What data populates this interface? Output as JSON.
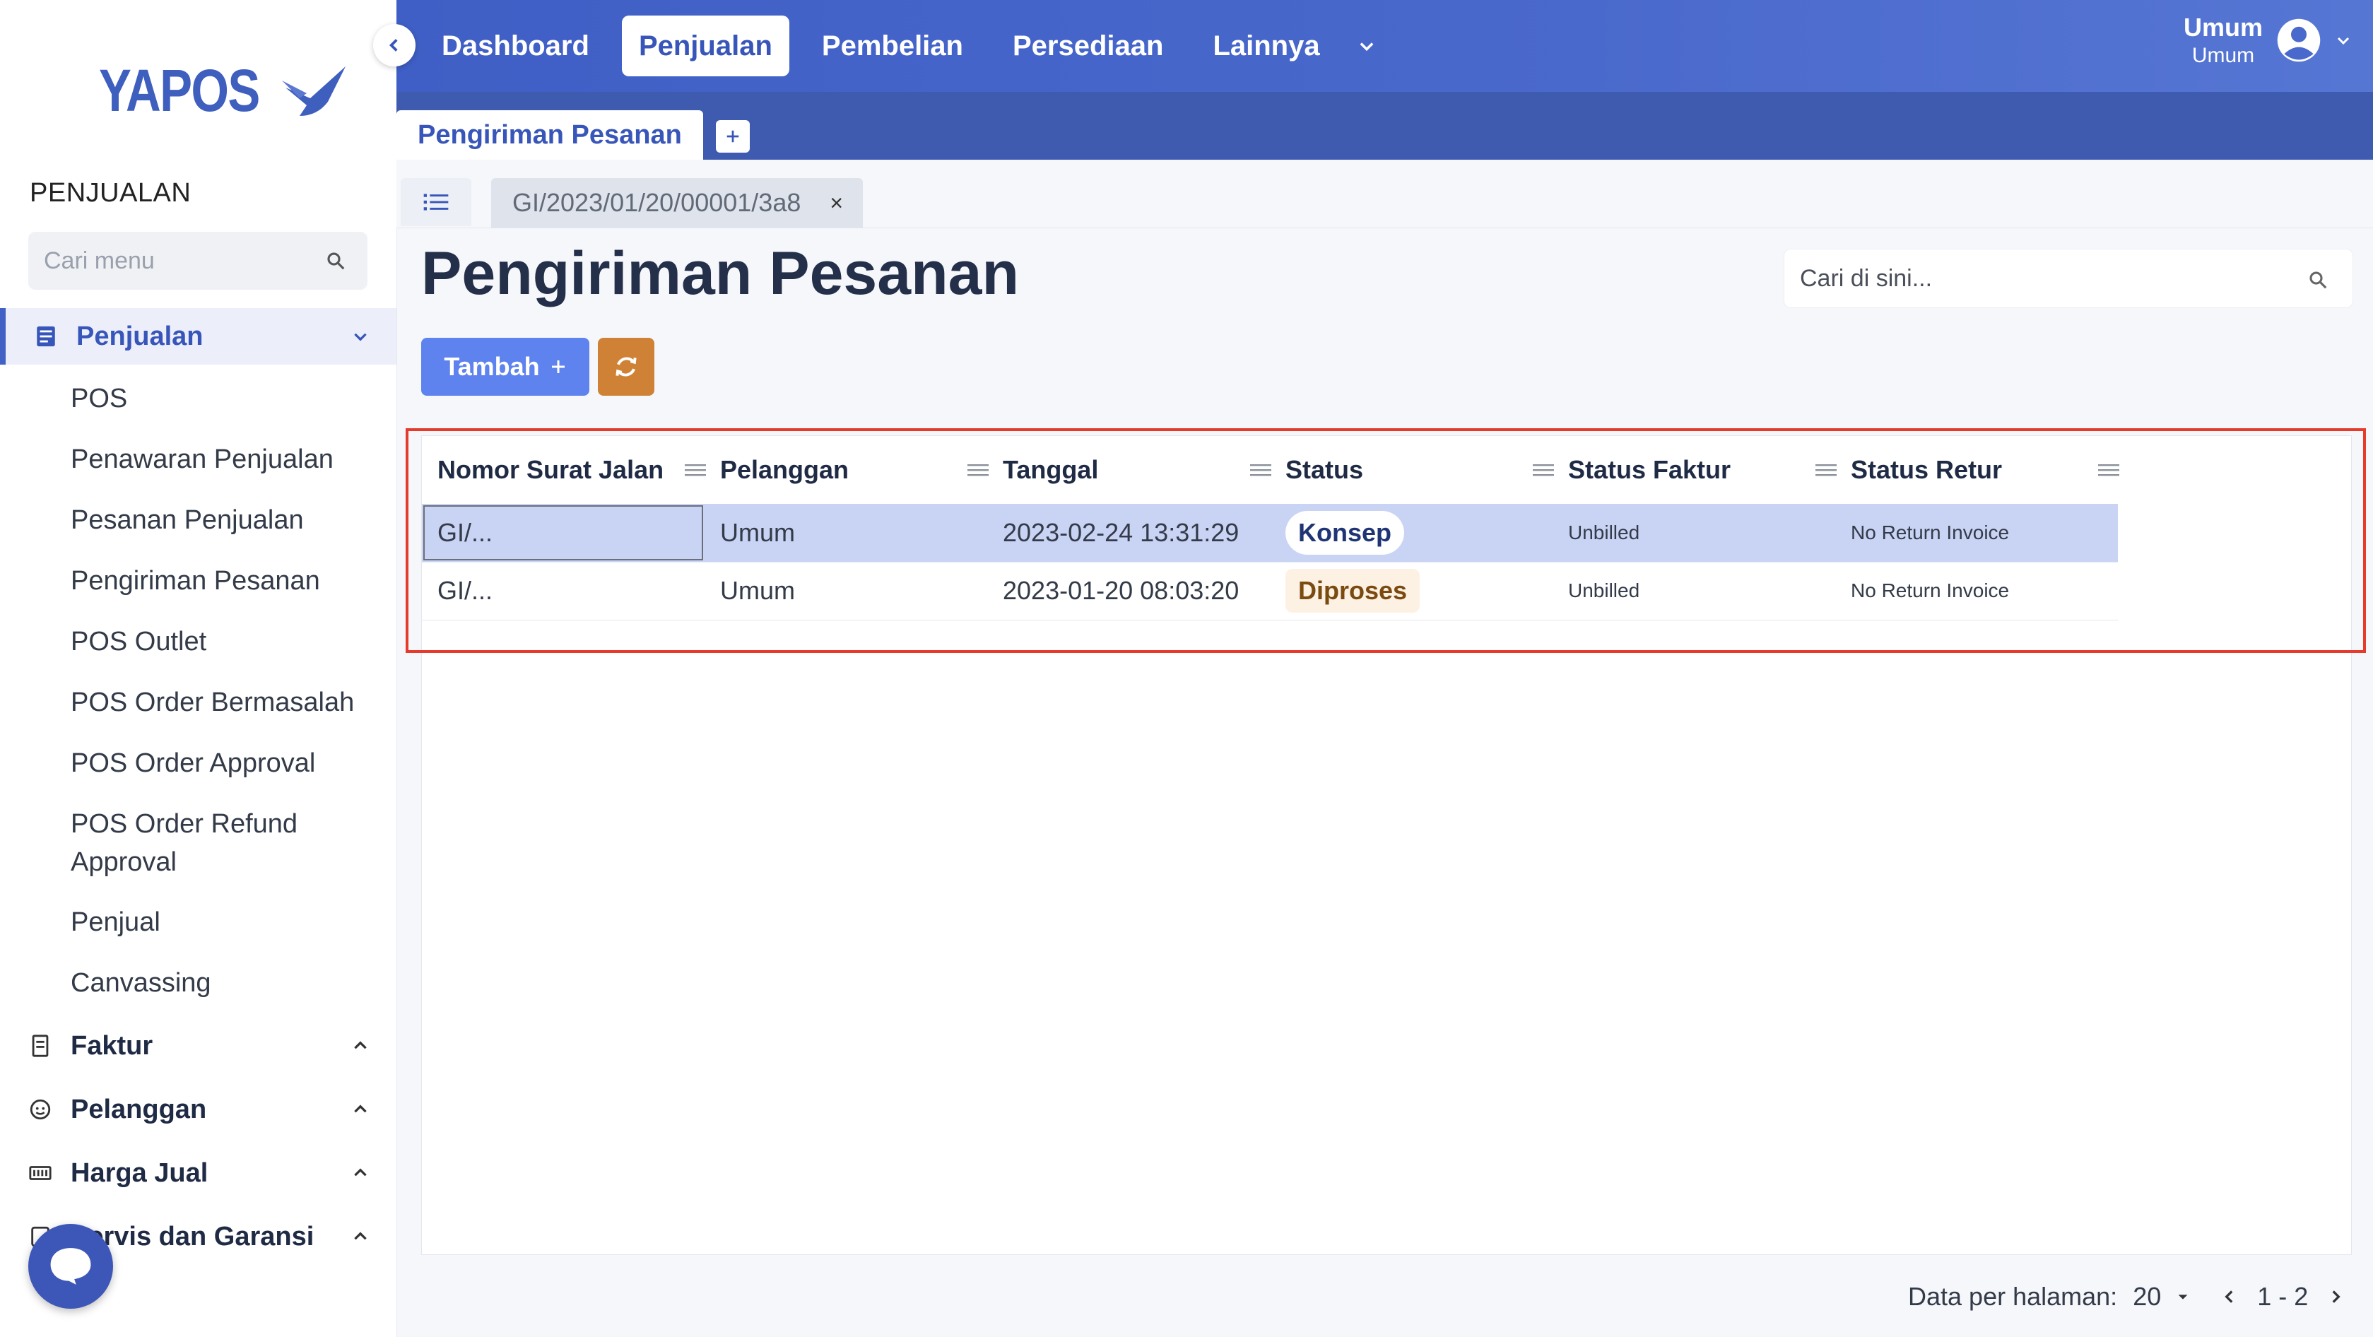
{
  "brand": {
    "name": "YAPOS"
  },
  "sidebar": {
    "section_title": "PENJUALAN",
    "search_placeholder": "Cari menu",
    "groups": [
      {
        "label": "Penjualan",
        "expanded": true
      },
      {
        "label": "Faktur"
      },
      {
        "label": "Pelanggan"
      },
      {
        "label": "Harga Jual"
      },
      {
        "label": "Servis dan Garansi"
      }
    ],
    "penjualan_items": [
      "POS",
      "Penawaran Penjualan",
      "Pesanan Penjualan",
      "Pengiriman Pesanan",
      "POS Outlet",
      "POS Order Bermasalah",
      "POS Order Approval",
      "POS Order Refund Approval",
      "Penjual",
      "Canvassing"
    ]
  },
  "topnav": {
    "items": [
      "Dashboard",
      "Penjualan",
      "Pembelian",
      "Persediaan",
      "Lainnya"
    ],
    "active": "Penjualan"
  },
  "user": {
    "name": "Umum",
    "role": "Umum"
  },
  "module_tab": "Pengiriman Pesanan",
  "doc_tab": "GI/2023/01/20/00001/3a8",
  "page": {
    "title": "Pengiriman Pesanan",
    "search_placeholder": "Cari di sini...",
    "add_button": "Tambah"
  },
  "table": {
    "columns": [
      "Nomor Surat Jalan",
      "Pelanggan",
      "Tanggal",
      "Status",
      "Status Faktur",
      "Status Retur"
    ],
    "rows": [
      {
        "nomor": "GI/...",
        "pelanggan": "Umum",
        "tanggal": "2023-02-24 13:31:29",
        "status": "Konsep",
        "faktur": "Unbilled",
        "retur": "No Return Invoice"
      },
      {
        "nomor": "GI/...",
        "pelanggan": "Umum",
        "tanggal": "2023-01-20 08:03:20",
        "status": "Diproses",
        "faktur": "Unbilled",
        "retur": "No Return Invoice"
      }
    ]
  },
  "pagination": {
    "label": "Data per halaman:",
    "per_page": "20",
    "range": "1 - 2"
  },
  "colors": {
    "primary": "#3f5fc6",
    "accent_button": "#5f83ee",
    "refresh_button": "#cf8235",
    "highlight": "#e53a2c"
  }
}
